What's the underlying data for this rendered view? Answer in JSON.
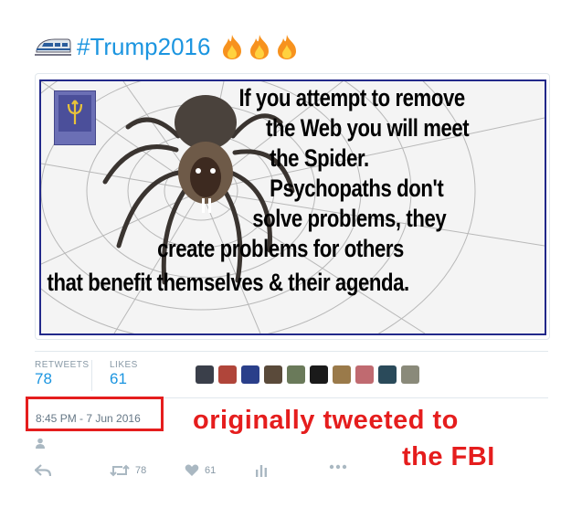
{
  "header": {
    "hashtag": "#Trump2016",
    "icons": [
      "train-icon",
      "fire-icon",
      "fire-icon",
      "fire-icon"
    ]
  },
  "meme": {
    "lines": [
      "If you attempt to remove",
      "the Web you will meet",
      "the Spider.",
      "Psychopaths don't",
      "solve problems, they",
      "create problems for others",
      "that benefit themselves & their agenda."
    ],
    "border_color": "#22298a"
  },
  "stats": {
    "retweets_label": "RETWEETS",
    "retweets_value": "78",
    "likes_label": "LIKES",
    "likes_value": "61",
    "avatar_count": 10
  },
  "timestamp": "8:45 PM - 7 Jun 2016",
  "annotation": {
    "line1": "originally tweeted to",
    "line2": "the FBI",
    "color": "#e51d1d"
  },
  "actions": {
    "reply": "",
    "retweet_count": "78",
    "like_count": "61",
    "analytics": "",
    "more": ""
  },
  "colors": {
    "link_blue": "#1b95e0",
    "muted": "#8899a6",
    "divider": "#e1e8ed"
  }
}
